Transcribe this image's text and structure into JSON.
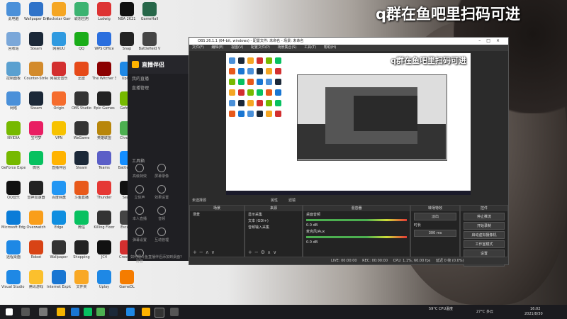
{
  "watermark": "q群在鱼吧里扫码可进",
  "desktop_icons": [
    {
      "label": "此电脑",
      "color": "#4a90d9"
    },
    {
      "label": "Wallpaper Engine",
      "color": "#2f73c9"
    },
    {
      "label": "Rockstar Games",
      "color": "#f5a623"
    },
    {
      "label": "联想应用",
      "color": "#3cb371"
    },
    {
      "label": "Ludwig",
      "color": "#d33"
    },
    {
      "label": "NBA 2K21",
      "color": "#111"
    },
    {
      "label": "GameHall",
      "color": "#276749"
    },
    {
      "label": "回收站",
      "color": "#7aa7d9"
    },
    {
      "label": "Steam",
      "color": "#1b2838"
    },
    {
      "label": "网易UU",
      "color": "#2f9ae0"
    },
    {
      "label": "QQ",
      "color": "#1aad19"
    },
    {
      "label": "WPS Office",
      "color": "#2b6fde"
    },
    {
      "label": "Snap",
      "color": "#222"
    },
    {
      "label": "Battlefield V",
      "color": "#444"
    },
    {
      "label": "控制面板",
      "color": "#5aa0d0"
    },
    {
      "label": "Counter-Strike",
      "color": "#d38b2c"
    },
    {
      "label": "网易云音乐",
      "color": "#d32f2f"
    },
    {
      "label": "迅雷",
      "color": "#e64a19"
    },
    {
      "label": "The Witcher 3",
      "color": "#8b0000"
    },
    {
      "label": "Uplay",
      "color": "#1e88e5"
    },
    {
      "label": "Chrome",
      "color": "#4caf50"
    },
    {
      "label": "网络",
      "color": "#4a90d9"
    },
    {
      "label": "Steam",
      "color": "#1b2838"
    },
    {
      "label": "Origin",
      "color": "#f56c2d"
    },
    {
      "label": "OBS Studio",
      "color": "#333"
    },
    {
      "label": "Epic Games",
      "color": "#222"
    },
    {
      "label": "Geforce",
      "color": "#76b900"
    },
    {
      "label": "Cloud",
      "color": "#3aa0d8"
    },
    {
      "label": "NVIDIA",
      "color": "#76b900"
    },
    {
      "label": "宝可梦",
      "color": "#e91e63"
    },
    {
      "label": "VPN",
      "color": "#f7c200"
    },
    {
      "label": "WeGame",
      "color": "#333"
    },
    {
      "label": "英雄联盟",
      "color": "#b8860b"
    },
    {
      "label": "Chrome",
      "color": "#4caf50"
    },
    {
      "label": "Origin",
      "color": "#555"
    },
    {
      "label": "GeForce Experience",
      "color": "#76b900"
    },
    {
      "label": "微信",
      "color": "#07c160"
    },
    {
      "label": "直播伴侣",
      "color": "#ffb300"
    },
    {
      "label": "Steam",
      "color": "#1b2838"
    },
    {
      "label": "Teams",
      "color": "#5b5fc7"
    },
    {
      "label": "Battle.net",
      "color": "#148eff"
    },
    {
      "label": "Tencent",
      "color": "#777"
    },
    {
      "label": "QQ音乐",
      "color": "#111"
    },
    {
      "label": "雷神加速器",
      "color": "#222"
    },
    {
      "label": "百度网盘",
      "color": "#2196f3"
    },
    {
      "label": "斗鱼直播",
      "color": "#e8591a"
    },
    {
      "label": "Thunder",
      "color": "#e53935"
    },
    {
      "label": "Sega",
      "color": "#111"
    },
    {
      "label": "QQ",
      "color": "#111"
    },
    {
      "label": "Microsoft Edge",
      "color": "#0a7cd8"
    },
    {
      "label": "Overwatch",
      "color": "#f99e1a"
    },
    {
      "label": "Edge",
      "color": "#0f8ee0"
    },
    {
      "label": "微信",
      "color": "#07c160"
    },
    {
      "label": "Killing Floor",
      "color": "#333"
    },
    {
      "label": "Escape",
      "color": "#444"
    },
    {
      "label": "Games",
      "color": "#222"
    },
    {
      "label": "远程桌面",
      "color": "#1e88e5"
    },
    {
      "label": "Robot",
      "color": "#d84315"
    },
    {
      "label": "Wallpaper",
      "color": "#333"
    },
    {
      "label": "Shopping",
      "color": "#222"
    },
    {
      "label": "JC4",
      "color": "#111"
    },
    {
      "label": "Crossfire",
      "color": "#d32f2f"
    },
    {
      "label": "Apps",
      "color": "#333"
    },
    {
      "label": "Visual Studio Code",
      "color": "#1e88e5"
    },
    {
      "label": "腾讯游戏",
      "color": "#fbc02d"
    },
    {
      "label": "Internet Explorer",
      "color": "#1976d2"
    },
    {
      "label": "文件夹",
      "color": "#f9a825"
    },
    {
      "label": "Uplay",
      "color": "#1e88e5"
    },
    {
      "label": "GameDL",
      "color": "#f57c00"
    }
  ],
  "assistant": {
    "title": "直播伴侣",
    "nav": [
      "我的直播",
      "直播管理"
    ],
    "section": "工具箱",
    "tools": [
      "高级特效",
      "屏幕录像",
      "立体声",
      "效果设置",
      "本人直播",
      "音频",
      "弹幕设置",
      "互动管理",
      "房管"
    ],
    "footer": "如何把斗鱼直播伴侣添加到桌面?"
  },
  "obs": {
    "title": "OBS 26.1.1 (64-bit, windows) - 配置文件: 未命名 - 场景: 未命名",
    "menu": [
      "文件(F)",
      "编辑(E)",
      "视图(V)",
      "配置文件(P)",
      "场景集合(S)",
      "工具(T)",
      "帮助(H)"
    ],
    "source_label": "未选择源",
    "tabs": [
      "属性",
      "滤镜"
    ],
    "panels": {
      "scenes": {
        "title": "场景",
        "items": [
          "场景"
        ]
      },
      "sources": {
        "title": "来源",
        "items": [
          "显示采集",
          "文本 (GDI+)",
          "音频输入采集"
        ]
      },
      "mixer": {
        "title": "混音器",
        "tracks": [
          {
            "name": "桌面音频",
            "level": "0.0 dB"
          },
          {
            "name": "麦克风/Aux",
            "level": "0.0 dB"
          }
        ]
      },
      "transitions": {
        "title": "转场特效",
        "type": "淡出",
        "duration_label": "时长",
        "duration": "300 ms"
      },
      "controls": {
        "title": "控件",
        "buttons": [
          "停止推流",
          "开始录制",
          "启动虚拟摄像机",
          "工作室模式",
          "设置",
          "退出"
        ]
      }
    },
    "status": {
      "live": "LIVE: 00:00:00",
      "rec": "REC: 00:00:00",
      "cpu": "CPU: 1.1%, 60.00 fps",
      "dropped": "延迟 0 帧 (0.0%)"
    }
  },
  "taskbar": {
    "weather": "27°C 多云",
    "cpu": "59°C CPU温度",
    "time": "16:02",
    "date": "2021/8/30"
  }
}
